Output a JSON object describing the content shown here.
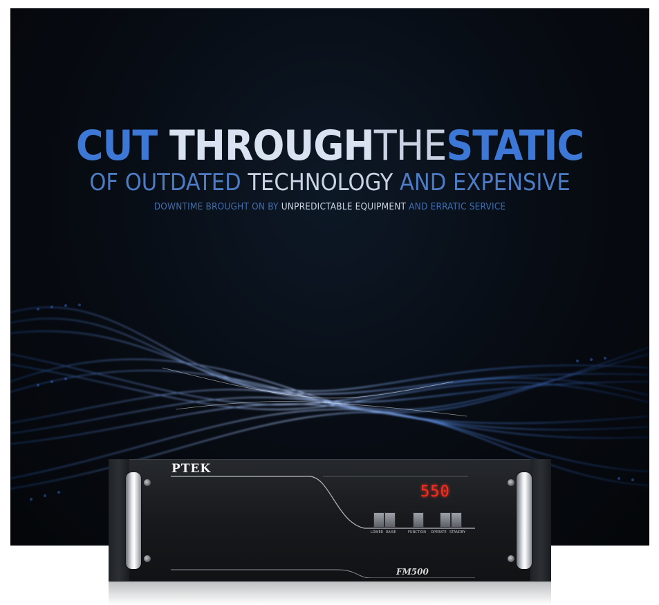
{
  "headline": {
    "word1": "CUT ",
    "word2": "THROUGH",
    "word3": "THE",
    "word4": "STATIC"
  },
  "subline": {
    "part1": "OF OUTDATED ",
    "part2": "TECHNOLOGY",
    "part3": " AND EXPENSIVE"
  },
  "tagline": {
    "part1": "DOWNTIME BROUGHT ON BY ",
    "part2": "UNPREDICTABLE EQUIPMENT",
    "part3": " AND ERRATIC SERVICE"
  },
  "device": {
    "brand": "PTEK",
    "display_value": "550",
    "model": "FM500",
    "button_labels": [
      "LOWER",
      "RAISE",
      "FUNCTION",
      "OPERATE",
      "STANDBY"
    ]
  },
  "colors": {
    "accent_blue": "#3d78d6",
    "text_light": "#d9e2f0",
    "background": "#070b12",
    "display_red": "#ff2a1c"
  }
}
